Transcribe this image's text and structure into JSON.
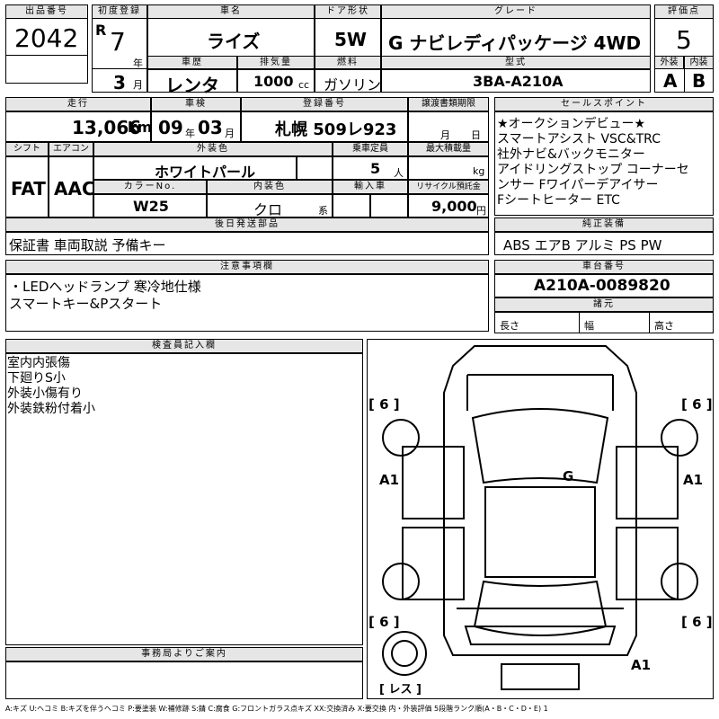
{
  "lot": {
    "label": "出品番号",
    "value": "2042"
  },
  "reg_date": {
    "label": "初度登録",
    "era": "R",
    "year": "7",
    "year_unit": "年",
    "month": "3",
    "month_unit": "月"
  },
  "car_name": {
    "label": "車名",
    "value": "ライズ"
  },
  "door": {
    "label": "ドア形状",
    "value": "5W"
  },
  "grade": {
    "label": "グレード",
    "value": "G ナビレディパッケージ 4WD"
  },
  "score": {
    "label": "評価点",
    "value": "5",
    "exterior_label": "外装",
    "exterior": "A",
    "interior_label": "内装",
    "interior": "B"
  },
  "history": {
    "label": "車歴",
    "value": "レンタ"
  },
  "displacement": {
    "label": "排気量",
    "value": "1000",
    "unit": "cc"
  },
  "fuel": {
    "label": "燃料",
    "value": "ガソリン"
  },
  "model_code": {
    "label": "型式",
    "value": "3BA-A210A"
  },
  "mileage": {
    "label": "走行",
    "value": "13,066",
    "unit": "km"
  },
  "inspection": {
    "label": "車検",
    "year": "09",
    "year_unit": "年",
    "month": "03",
    "month_unit": "月"
  },
  "plate": {
    "label": "登録番号",
    "value": "札幌 509レ923"
  },
  "transfer": {
    "label": "譲渡書類期限",
    "month_unit": "月",
    "day_unit": "日"
  },
  "selling_points": {
    "label": "セールスポイント",
    "lines": [
      "★オークションデビュー★",
      "スマートアシスト VSC&TRC",
      "社外ナビ&バックモニター",
      "アイドリングストップ コーナーセ",
      "ンサー Fワイパーデアイサー",
      "Fシートヒーター ETC"
    ]
  },
  "shift": {
    "label": "シフト",
    "value": "FAT"
  },
  "aircon": {
    "label": "エアコン",
    "value": "AAC"
  },
  "ext_color": {
    "label": "外装色",
    "value": "ホワイトパール"
  },
  "capacity": {
    "label": "乗車定員",
    "value": "5",
    "unit": "人"
  },
  "max_load": {
    "label": "最大積載量",
    "unit": "kg"
  },
  "color_no": {
    "label": "カラーNo.",
    "value": "W25"
  },
  "int_color": {
    "label": "内装色",
    "value": "クロ",
    "unit": "系"
  },
  "import": {
    "label": "輸入車"
  },
  "recycle": {
    "label": "リサイクル預託金",
    "value": "9,000",
    "unit": "円"
  },
  "later_parts": {
    "label": "後日発送部品",
    "value": "保証書 車両取説 予備キー"
  },
  "equipment": {
    "label": "純正装備",
    "value": "ABS エアB アルミ PS PW"
  },
  "notes": {
    "label": "注意事項欄",
    "lines": [
      "・LEDヘッドランプ 寒冷地仕様",
      "スマートキー&Pスタート"
    ]
  },
  "chassis": {
    "label": "車台番号",
    "value": "A210A-0089820"
  },
  "dims": {
    "label": "諸元",
    "length": "長さ",
    "width": "幅",
    "height": "高さ"
  },
  "inspector": {
    "label": "検査員記入欄",
    "lines": [
      "室内内張傷",
      "下廻りS小",
      "外装小傷有り",
      "外装鉄粉付着小"
    ]
  },
  "office": {
    "label": "事務局よりご案内"
  },
  "diagram": {
    "marks": {
      "fl_tire": "[ 6 ]",
      "fr_tire": "[ 6 ]",
      "rl_tire": "[ 6 ]",
      "rr_tire": "[ 6 ]",
      "left": "A1",
      "right": "A1",
      "roof": "G",
      "rear": "A1",
      "spare": "[ レス ]"
    }
  },
  "legend": "A:キズ U:ヘコミ B:キズを伴うヘコミ P:要塗装 W:補修跡 S:錆 C:腐食 G:フロントガラス点キズ XX:交換済み X:要交換 内・外装評価 5段階ランク順(A・B・C・D・E) 1"
}
